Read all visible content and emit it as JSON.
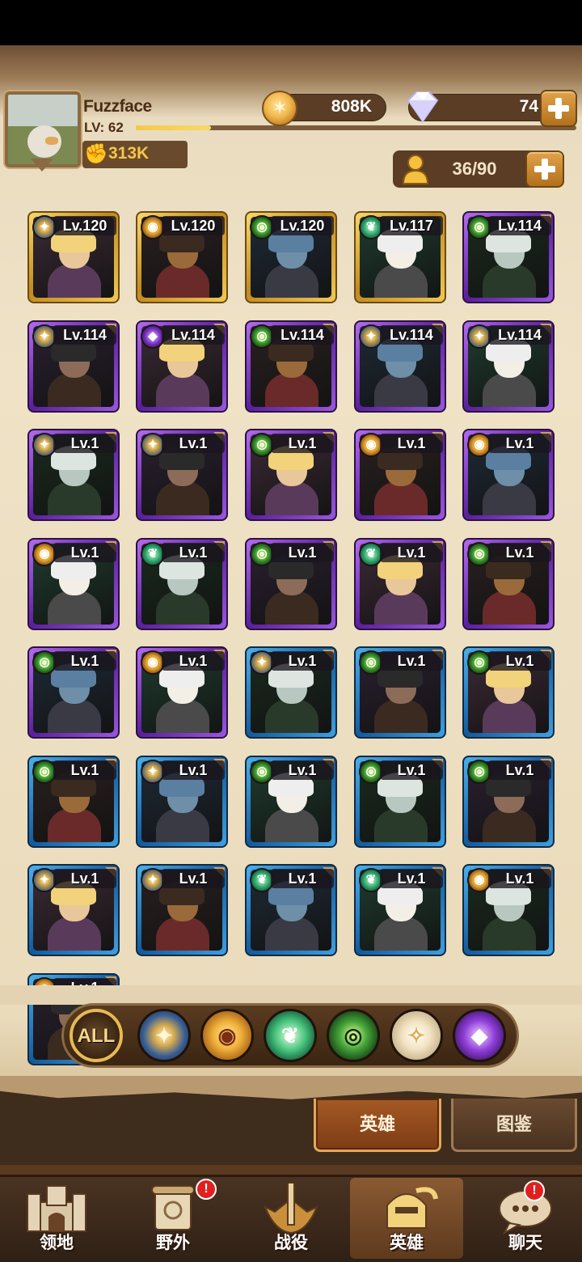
{
  "player": {
    "name": "Fuzzface",
    "level": "LV: 62",
    "xp_fraction": 0.17,
    "power": "313K"
  },
  "resources": {
    "gold": "808K",
    "diamonds": "74",
    "hero_slots": "36/90"
  },
  "heroes": [
    {
      "level": "Lv.120",
      "rarity": "gold",
      "faction": "lightbearer"
    },
    {
      "level": "Lv.120",
      "rarity": "gold",
      "faction": "mauler"
    },
    {
      "level": "Lv.120",
      "rarity": "gold",
      "faction": "graveborn"
    },
    {
      "level": "Lv.117",
      "rarity": "gold",
      "faction": "wilder"
    },
    {
      "level": "Lv.114",
      "rarity": "purple",
      "faction": "graveborn"
    },
    {
      "level": "Lv.114",
      "rarity": "purple",
      "faction": "lightbearer"
    },
    {
      "level": "Lv.114",
      "rarity": "purple",
      "faction": "hypogean"
    },
    {
      "level": "Lv.114",
      "rarity": "purple",
      "faction": "graveborn"
    },
    {
      "level": "Lv.114",
      "rarity": "purple",
      "faction": "lightbearer"
    },
    {
      "level": "Lv.114",
      "rarity": "purple",
      "faction": "lightbearer"
    },
    {
      "level": "Lv.1",
      "rarity": "purple",
      "faction": "lightbearer"
    },
    {
      "level": "Lv.1",
      "rarity": "purple",
      "faction": "lightbearer"
    },
    {
      "level": "Lv.1",
      "rarity": "purple",
      "faction": "graveborn"
    },
    {
      "level": "Lv.1",
      "rarity": "purple",
      "faction": "mauler"
    },
    {
      "level": "Lv.1",
      "rarity": "purple",
      "faction": "mauler"
    },
    {
      "level": "Lv.1",
      "rarity": "purple",
      "faction": "mauler"
    },
    {
      "level": "Lv.1",
      "rarity": "purple",
      "faction": "wilder"
    },
    {
      "level": "Lv.1",
      "rarity": "purple",
      "faction": "graveborn"
    },
    {
      "level": "Lv.1",
      "rarity": "purple",
      "faction": "wilder"
    },
    {
      "level": "Lv.1",
      "rarity": "purple",
      "faction": "graveborn"
    },
    {
      "level": "Lv.1",
      "rarity": "purple",
      "faction": "graveborn"
    },
    {
      "level": "Lv.1",
      "rarity": "purple",
      "faction": "mauler"
    },
    {
      "level": "Lv.1",
      "rarity": "blue",
      "faction": "lightbearer"
    },
    {
      "level": "Lv.1",
      "rarity": "blue",
      "faction": "graveborn"
    },
    {
      "level": "Lv.1",
      "rarity": "blue",
      "faction": "graveborn"
    },
    {
      "level": "Lv.1",
      "rarity": "blue",
      "faction": "graveborn"
    },
    {
      "level": "Lv.1",
      "rarity": "blue",
      "faction": "lightbearer"
    },
    {
      "level": "Lv.1",
      "rarity": "blue",
      "faction": "graveborn"
    },
    {
      "level": "Lv.1",
      "rarity": "blue",
      "faction": "graveborn"
    },
    {
      "level": "Lv.1",
      "rarity": "blue",
      "faction": "graveborn"
    },
    {
      "level": "Lv.1",
      "rarity": "blue",
      "faction": "lightbearer"
    },
    {
      "level": "Lv.1",
      "rarity": "blue",
      "faction": "lightbearer"
    },
    {
      "level": "Lv.1",
      "rarity": "blue",
      "faction": "wilder"
    },
    {
      "level": "Lv.1",
      "rarity": "blue",
      "faction": "wilder"
    },
    {
      "level": "Lv.1",
      "rarity": "blue",
      "faction": "mauler"
    },
    {
      "level": "Lv.1",
      "rarity": "blue",
      "faction": "mauler"
    }
  ],
  "filters": {
    "all_label": "ALL"
  },
  "subtabs": {
    "heroes": "英雄",
    "codex": "图鉴"
  },
  "nav": [
    {
      "label": "领地",
      "badge": ""
    },
    {
      "label": "野外",
      "badge": "!"
    },
    {
      "label": "战役",
      "badge": ""
    },
    {
      "label": "英雄",
      "badge": ""
    },
    {
      "label": "聊天",
      "badge": "!"
    }
  ],
  "colors": {
    "gold_frame": "#e0b03a",
    "purple_frame": "#7a35c4",
    "blue_frame": "#2a8ad0",
    "accent": "#f7c548"
  }
}
